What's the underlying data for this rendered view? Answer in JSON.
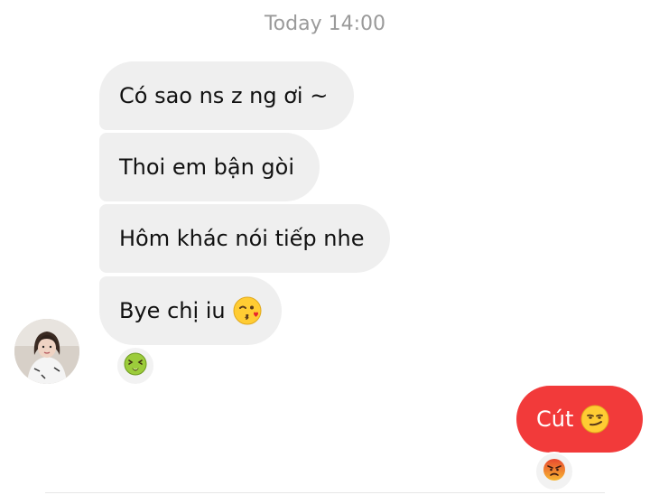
{
  "chat": {
    "timestamp": "Today 14:00",
    "incoming": [
      {
        "text": "Có sao ns z ng ơi ~"
      },
      {
        "text": "Thoi em bận gòi"
      },
      {
        "text": "Hôm khác nói tiếp nhe"
      },
      {
        "text": "Bye chị iu",
        "emoji": "kissing-wink-emoji"
      }
    ],
    "incoming_reaction": "nauseated-face-emoji",
    "outgoing": {
      "text": "Cút",
      "emoji": "smirk-emoji",
      "color": "#f23a3a"
    },
    "outgoing_reaction": "angry-face-emoji",
    "avatar": "contact-avatar"
  }
}
